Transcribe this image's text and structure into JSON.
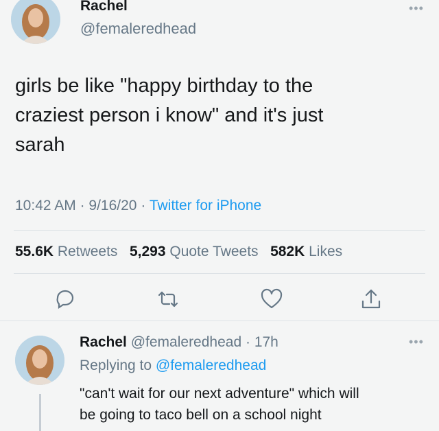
{
  "tweet": {
    "author_name": "Rachel",
    "author_handle": "@femaleredhead",
    "more": "•••",
    "text_lines": [
      "girls be like \"happy birthday to the",
      "craziest person i know\" and it's just",
      "sarah"
    ],
    "time": "10:42 AM",
    "date": "9/16/20",
    "separator": "·",
    "source": "Twitter for iPhone",
    "stats": {
      "retweets_count": "55.6K",
      "retweets_label": "Retweets",
      "quotes_count": "5,293",
      "quotes_label": "Quote Tweets",
      "likes_count": "582K",
      "likes_label": "Likes"
    }
  },
  "reply": {
    "author_name": "Rachel",
    "author_handle": "@femaleredhead",
    "age": "17h",
    "separator": "·",
    "more": "•••",
    "replying_prefix": "Replying to",
    "replying_handle": "@femaleredhead",
    "text_lines": [
      "\"can't wait for our next adventure\" which will",
      "be going to taco bell on a school night"
    ]
  },
  "icons": {
    "reply": "reply-icon",
    "retweet": "retweet-icon",
    "like": "heart-icon",
    "share": "share-icon"
  },
  "colors": {
    "link": "#1d9bf0",
    "secondary": "#657786",
    "text": "#14171a"
  }
}
